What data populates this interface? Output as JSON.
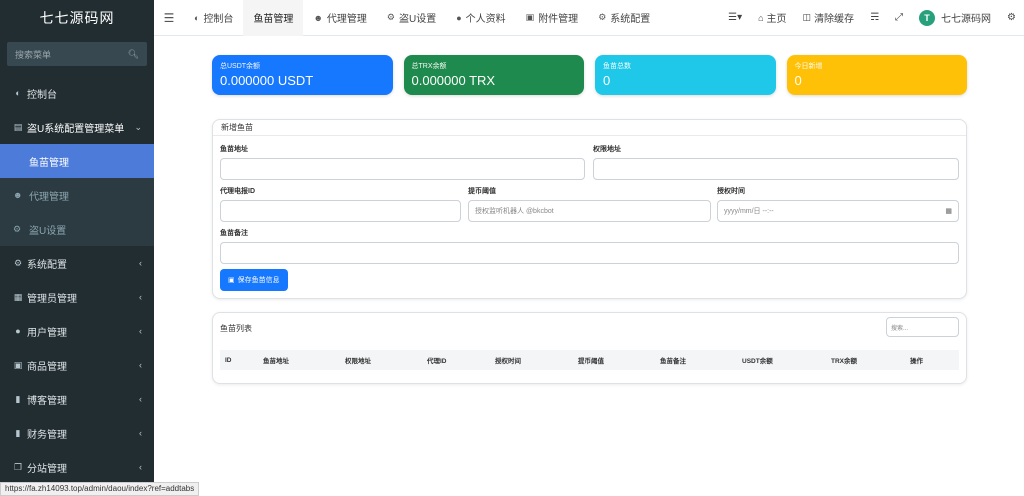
{
  "app": {
    "title": "七七源码网"
  },
  "sidebar": {
    "search_placeholder": "搜索菜单",
    "items": [
      {
        "label": "控制台",
        "icon": "dashboard-icon"
      },
      {
        "label": "盗U系统配置管理菜单",
        "icon": "monitor-icon"
      },
      {
        "label": "系统配置",
        "icon": "cogs-icon"
      },
      {
        "label": "管理员管理",
        "icon": "windows-icon"
      },
      {
        "label": "用户管理",
        "icon": "user-icon"
      },
      {
        "label": "商品管理",
        "icon": "cart-icon"
      },
      {
        "label": "博客管理",
        "icon": "book-icon"
      },
      {
        "label": "财务管理",
        "icon": "bookmark-icon"
      },
      {
        "label": "分站管理",
        "icon": "clone-icon"
      }
    ],
    "submenu": [
      {
        "label": "鱼苗管理"
      },
      {
        "label": "代理管理"
      },
      {
        "label": "盗U设置"
      }
    ]
  },
  "topbar": {
    "tabs": [
      {
        "label": "控制台"
      },
      {
        "label": "鱼苗管理"
      },
      {
        "label": "代理管理"
      },
      {
        "label": "盗U设置"
      },
      {
        "label": "个人资料"
      },
      {
        "label": "附件管理"
      },
      {
        "label": "系统配置"
      }
    ],
    "home": "主页",
    "clear_cache": "清除缓存",
    "site_name": "七七源码网"
  },
  "cards": [
    {
      "label": "总USDT余额",
      "value": "0.000000 USDT",
      "color": "#1677ff"
    },
    {
      "label": "总TRX余额",
      "value": "0.000000 TRX",
      "color": "#1f8a4d"
    },
    {
      "label": "鱼苗总数",
      "value": "0",
      "color": "#1fc8e8"
    },
    {
      "label": "今日新增",
      "value": "0",
      "color": "#ffc107"
    }
  ],
  "form": {
    "title": "新增鱼苗",
    "address_label": "鱼苗地址",
    "perm_label": "权限地址",
    "agent_label": "代理电报ID",
    "threshold_label": "提币阈值",
    "threshold_placeholder": "授权监听机器人 @bkcbot",
    "time_label": "授权时间",
    "time_placeholder": "yyyy/mm/日 --:--",
    "remark_label": "鱼苗备注",
    "save_label": "保存鱼苗信息"
  },
  "list": {
    "title": "鱼苗列表",
    "search_placeholder": "搜索...",
    "columns": [
      "ID",
      "鱼苗地址",
      "权限地址",
      "代理ID",
      "授权时间",
      "提币阈值",
      "鱼苗备注",
      "USDT余额",
      "TRX余额",
      "操作"
    ]
  },
  "status_url": "https://fa.zh14093.top/admin/daou/index?ref=addtabs"
}
